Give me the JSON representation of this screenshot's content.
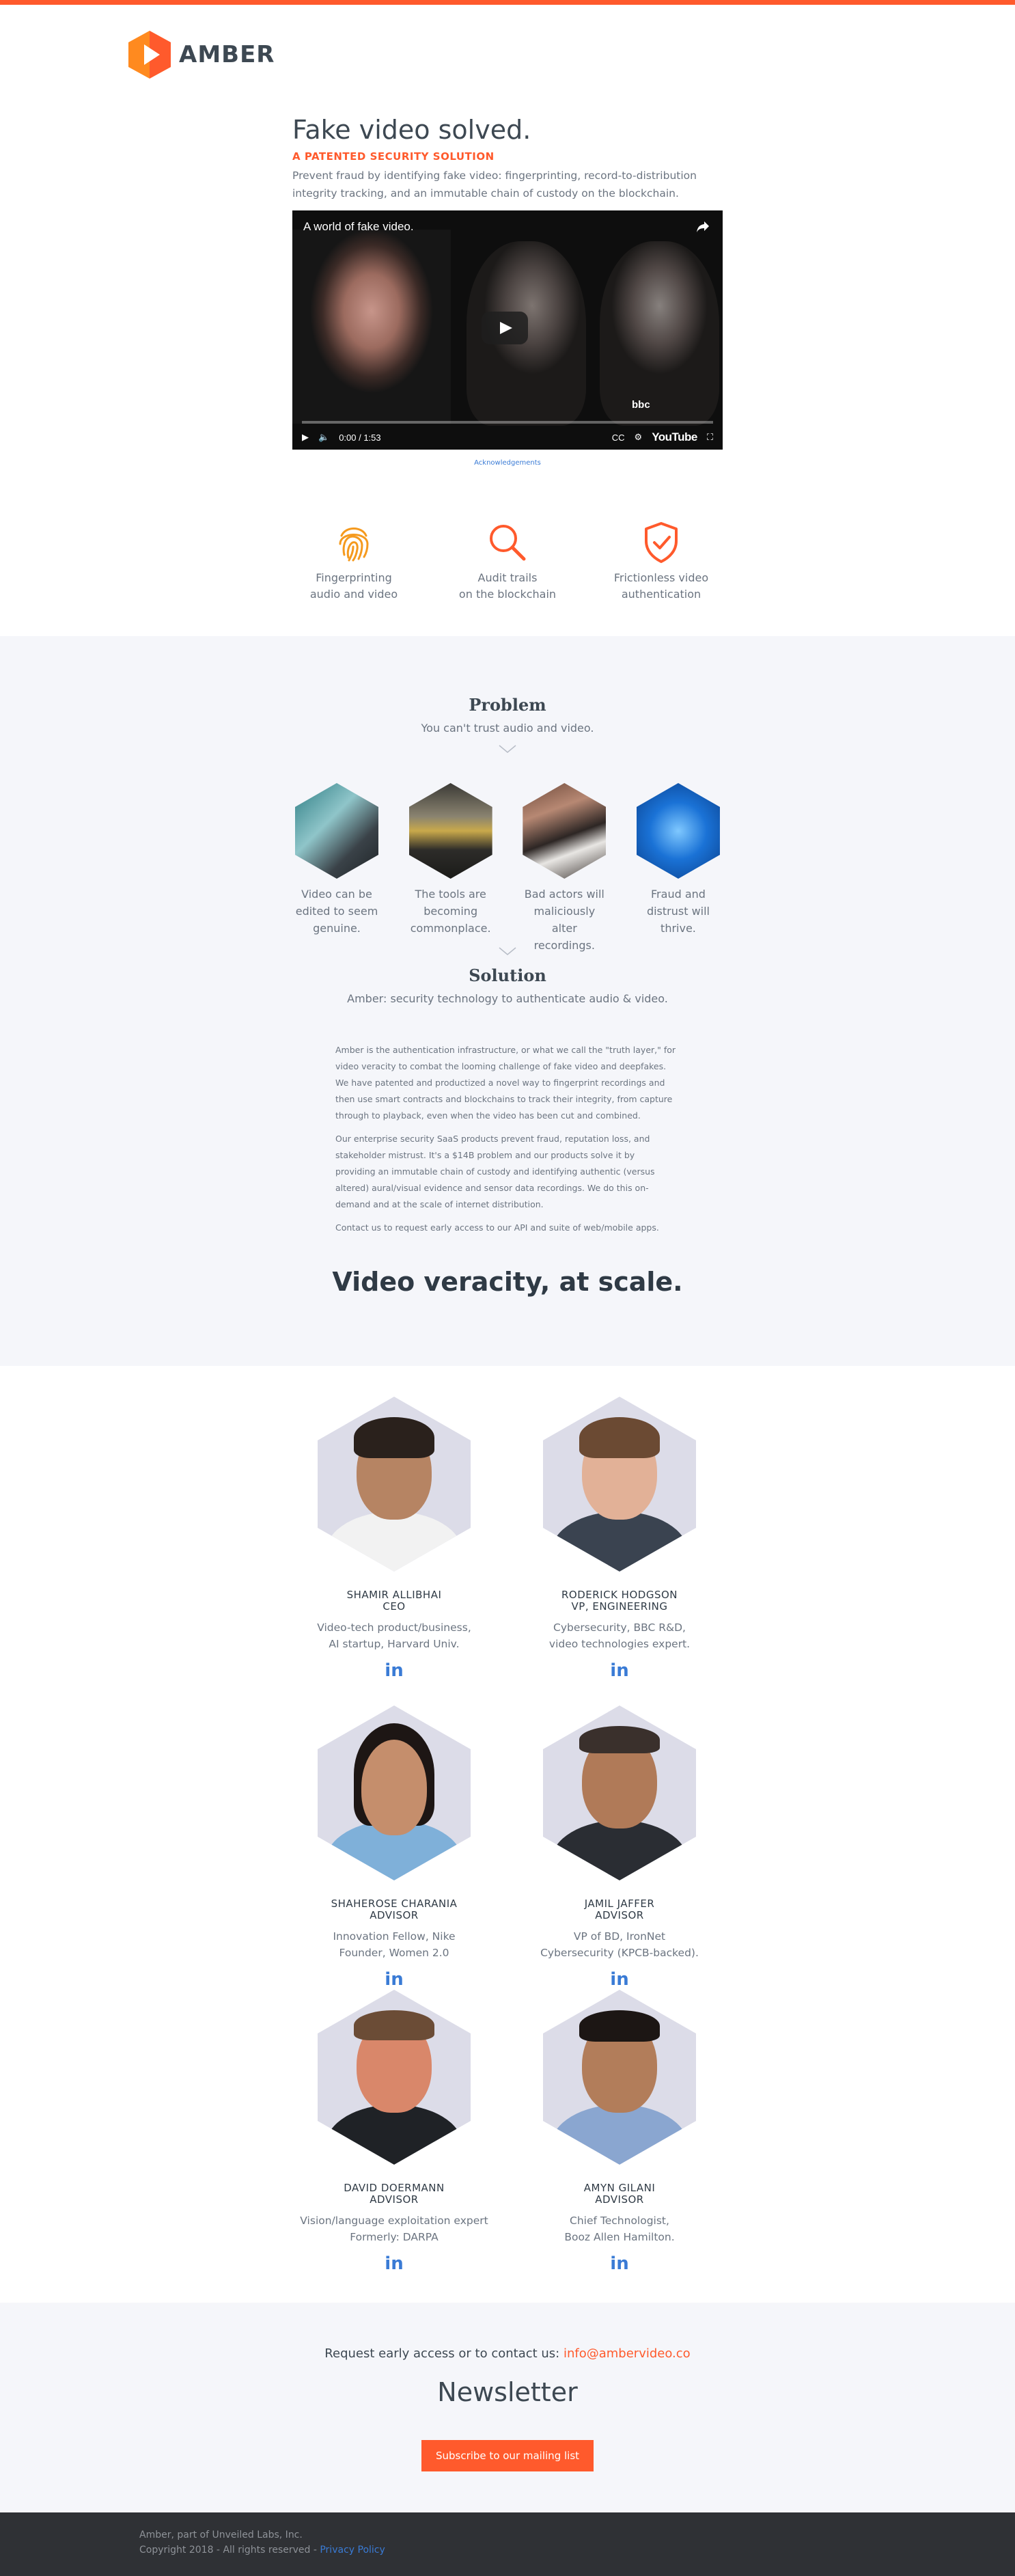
{
  "brand": {
    "name": "AMBER",
    "accent": "#ff5a2c",
    "logo_icon": "play-hexagon-icon"
  },
  "hero": {
    "title": "Fake video solved.",
    "kicker": "A PATENTED SECURITY SOLUTION",
    "description": "Prevent fraud by identifying fake video: fingerprinting, record-to-distribution integrity tracking, and an immutable chain of custody on the blockchain.",
    "video": {
      "title": "A world of fake video.",
      "watermark": "bbc",
      "time": "0:00 / 1:53",
      "platform": "YouTube",
      "cc": "CC"
    },
    "acknowledgements": "Acknowledgements"
  },
  "features": [
    {
      "icon": "fingerprint-icon",
      "line1": "Fingerprinting",
      "line2": "audio and video"
    },
    {
      "icon": "magnifier-icon",
      "line1": "Audit trails",
      "line2": "on the blockchain"
    },
    {
      "icon": "shield-check-icon",
      "line1": "Frictionless video",
      "line2": "authentication"
    }
  ],
  "problem": {
    "title": "Problem",
    "subtitle": "You can't trust audio and video.",
    "items": [
      {
        "line1": "Video can be",
        "line2": "edited to seem",
        "line3": "genuine."
      },
      {
        "line1": "The tools are",
        "line2": "becoming",
        "line3": "commonplace."
      },
      {
        "line1": "Bad actors will",
        "line2": "maliciously alter",
        "line3": "recordings."
      },
      {
        "line1": "Fraud and",
        "line2": "distrust will",
        "line3": "thrive."
      }
    ]
  },
  "solution": {
    "title": "Solution",
    "subtitle": "Amber: security technology to authenticate audio & video.",
    "p1": "Amber is the authentication infrastructure, or what we call the \"truth layer,\" for video veracity to combat the looming challenge of fake video and deepfakes. We have patented and productized a novel way to fingerprint recordings and then use smart contracts and blockchains to track their integrity, from capture through to playback, even when the video has been cut and combined.",
    "p2": "Our enterprise security SaaS products prevent fraud, reputation loss, and stakeholder mistrust. It's a $14B problem and our products solve it by providing an immutable chain of custody and identifying authentic (versus altered) aural/visual evidence and sensor data recordings. We do this on-demand and at the scale of internet distribution.",
    "p3": "Contact us to request early access to our API and suite of web/mobile apps.",
    "tagline": "Video veracity, at scale."
  },
  "team": [
    {
      "name": "SHAMIR ALLIBHAI",
      "role": "CEO",
      "d1": "Video-tech product/business,",
      "d2": "AI  startup, Harvard Univ.",
      "link": "in"
    },
    {
      "name": "RODERICK HODGSON",
      "role": "VP, ENGINEERING",
      "d1": "Cybersecurity, BBC R&D,",
      "d2": "video technologies expert.",
      "link": "in"
    },
    {
      "name": "SHAHEROSE CHARANIA",
      "role": "ADVISOR",
      "d1": "Innovation Fellow, Nike",
      "d2": "Founder, Women 2.0",
      "link": "in"
    },
    {
      "name": "JAMIL JAFFER",
      "role": "ADVISOR",
      "d1": "VP of BD, IronNet",
      "d2": "Cybersecurity (KPCB-backed).",
      "link": "in"
    },
    {
      "name": "DAVID DOERMANN",
      "role": "ADVISOR",
      "d1": "Vision/language exploitation expert",
      "d2": "Formerly: DARPA",
      "link": "in"
    },
    {
      "name": "AMYN GILANI",
      "role": "ADVISOR",
      "d1": "Chief Technologist,",
      "d2": "Booz Allen Hamilton.",
      "link": "in"
    }
  ],
  "contact": {
    "prefix": "Request early access or to contact us: ",
    "email": "info@ambervideo.co",
    "newsletter_title": "Newsletter",
    "subscribe_label": "Subscribe to our mailing list"
  },
  "footer": {
    "line1": "Amber, part of Unveiled Labs, Inc.",
    "line2": "Copyright 2018 - All rights reserved - ",
    "privacy": "Privacy Policy"
  }
}
